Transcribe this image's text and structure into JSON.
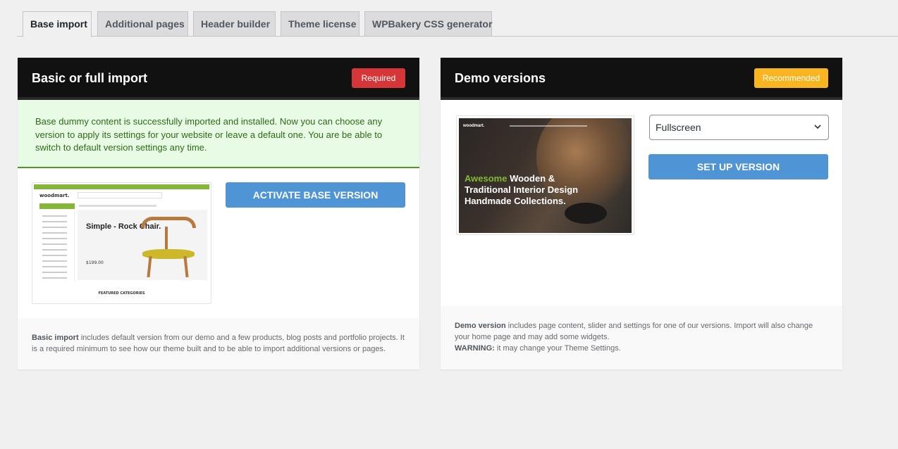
{
  "tabs": [
    {
      "label": "Base import",
      "active": true
    },
    {
      "label": "Additional pages",
      "active": false
    },
    {
      "label": "Header builder",
      "active": false
    },
    {
      "label": "Theme license",
      "active": false
    },
    {
      "label": "WPBakery CSS generator",
      "active": false
    }
  ],
  "basic_panel": {
    "title": "Basic or full import",
    "badge": "Required",
    "badge_color": "#d63638",
    "notice": "Base dummy content is successfully imported and installed. Now you can choose any version to apply its settings for your website or leave a default one. You are be able to switch to default version settings any time.",
    "preview": {
      "logo": "woodmart.",
      "hero_title": "Simple - Rock Chair.",
      "price": "$199.00",
      "section_title": "FEATURED CATEGORIES"
    },
    "button": "ACTIVATE BASE VERSION",
    "footer_strong": "Basic import",
    "footer_text": " includes default version from our demo and a few products, blog posts and portfolio projects. It is a required minimum to see how our theme built and to be able to import additional versions or pages."
  },
  "demo_panel": {
    "title": "Demo versions",
    "badge": "Recommended",
    "badge_color": "#f8b520",
    "preview": {
      "logo": "woodmart.",
      "headline_accent": "Awesome",
      "headline_rest_1": " Wooden &",
      "headline_line_2": "Traditional Interior Design",
      "headline_line_3": "Handmade Collections."
    },
    "select_value": "Fullscreen",
    "button": "SET UP VERSION",
    "footer_strong": "Demo version",
    "footer_text": " includes page content, slider and settings for one of our versions. Import will also change your home page and may add some widgets.",
    "warning_strong": "WARNING:",
    "warning_text": " it may change your Theme Settings."
  },
  "colors": {
    "accent_blue": "#4f94d4",
    "brand_green": "#83b735",
    "header_dark": "#111111"
  }
}
